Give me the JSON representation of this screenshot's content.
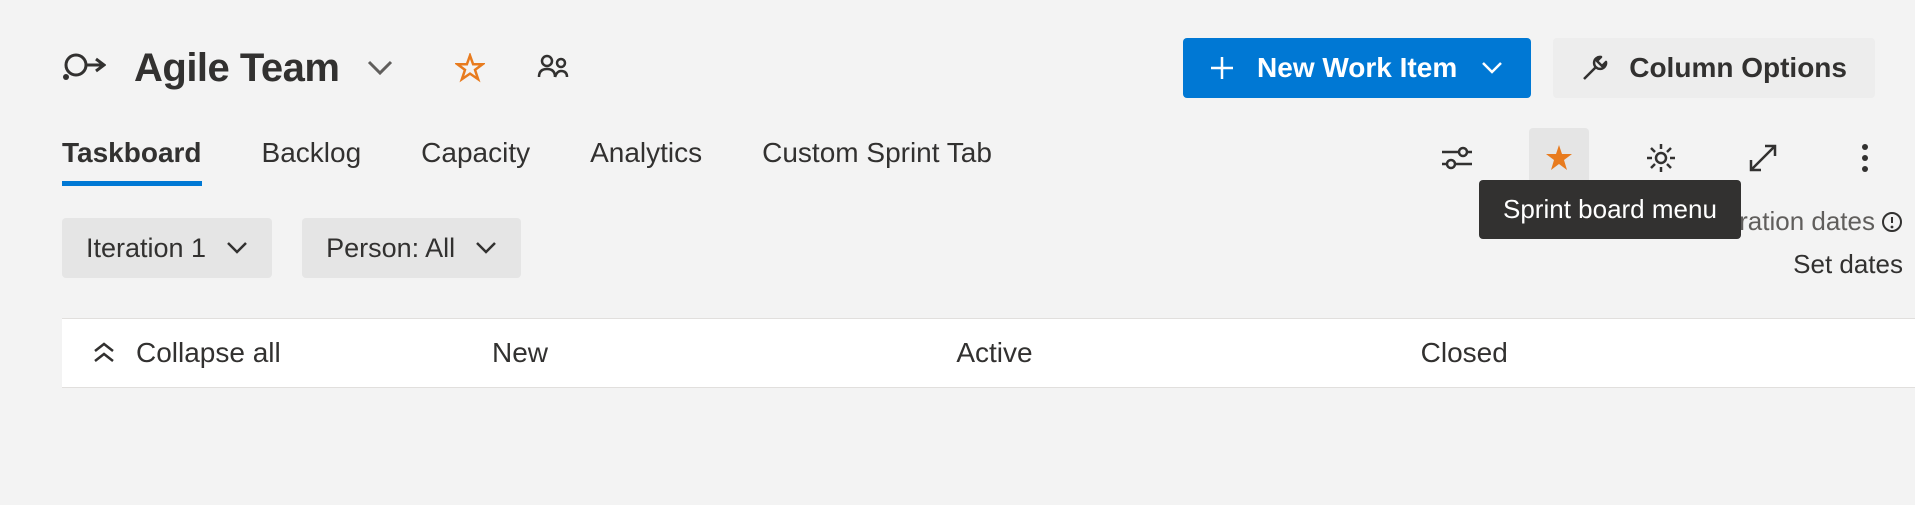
{
  "header": {
    "team_name": "Agile Team",
    "new_work_item_label": "New Work Item",
    "column_options_label": "Column Options"
  },
  "tabs": {
    "items": [
      "Taskboard",
      "Backlog",
      "Capacity",
      "Analytics",
      "Custom Sprint Tab"
    ],
    "active_index": 0
  },
  "filters": {
    "iteration": "Iteration 1",
    "person": "Person: All"
  },
  "meta": {
    "no_dates": "No iteration dates",
    "set_dates": "Set dates"
  },
  "tooltip": {
    "sprint_board_menu": "Sprint board menu"
  },
  "board": {
    "collapse_all": "Collapse all",
    "columns": [
      "New",
      "Active",
      "Closed"
    ]
  },
  "colors": {
    "primary": "#0078d4",
    "accent_orange": "#e87b1e"
  }
}
